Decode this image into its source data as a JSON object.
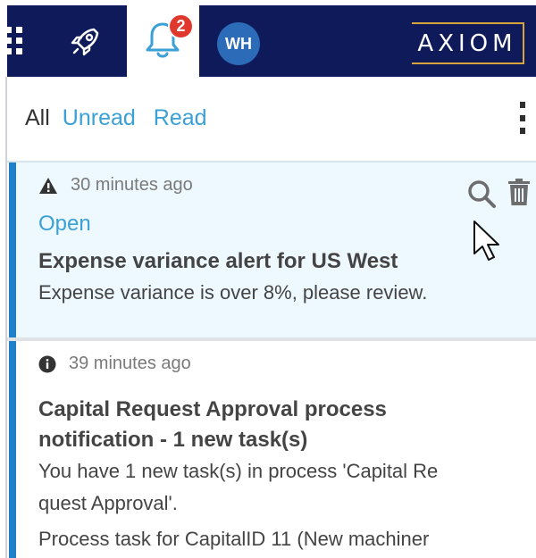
{
  "topbar": {
    "icons": [
      "grid-icon",
      "rocket-icon",
      "bell-icon",
      "avatar"
    ],
    "notification_count": "2",
    "avatar_initials": "WH",
    "logo_text": "AXIOM",
    "colors": {
      "nav": "#0f1a5a",
      "badge": "#e1382e",
      "avatar": "#2c6bb8",
      "logo_border": "#d9a53b"
    }
  },
  "filters": {
    "all_label": "All",
    "unread_label": "Unread",
    "read_label": "Read",
    "selected": "All",
    "colors": {
      "link": "#3aa0d6",
      "selected": "#333333"
    }
  },
  "notifications": [
    {
      "icon": "warning-icon",
      "time": "30 minutes ago",
      "status": "Open",
      "title": "Expense variance alert for US West",
      "body": [
        "Expense variance is over 8%, please review."
      ],
      "actions": [
        "search-icon",
        "trash-icon"
      ],
      "highlighted": true
    },
    {
      "icon": "info-icon",
      "time": "39 minutes ago",
      "title": "Capital Request Approval process notification - 1 new task(s)",
      "body": [
        "You have 1 new task(s) in process 'Capital Re",
        "quest Approval'.",
        "Process task for CapitalID 11 (New machiner"
      ],
      "highlighted": false
    }
  ],
  "colors": {
    "card_highlight": "#eef9ff",
    "card_bar": "#1f7fc7"
  }
}
